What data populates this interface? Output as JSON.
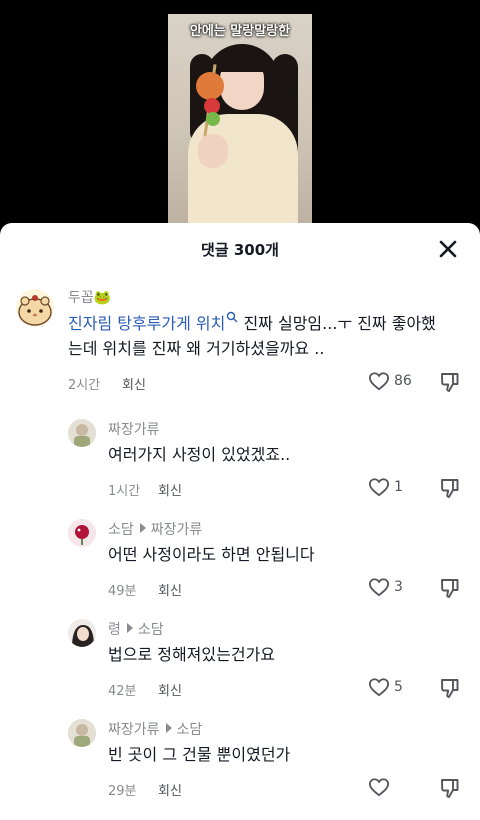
{
  "video": {
    "caption": "안에는 말랑말랑한"
  },
  "sheet": {
    "title": "댓글 300개"
  },
  "comments": [
    {
      "username": "두꼽🐸",
      "tag": "진자림 탕후루가게 위치",
      "text_line1": " 진짜 실망임...ㅜ 진짜 좋아했",
      "text_line2": "는데 위치를 진짜 왜 거기하셨을까요 ..",
      "time": "2시간",
      "reply_label": "회신",
      "likes": "86"
    },
    {
      "username": "짜장가류",
      "text": "여러가지 사정이 있었겠죠..",
      "time": "1시간",
      "reply_label": "회신",
      "likes": "1"
    },
    {
      "username": "소담",
      "reply_to": "짜장가류",
      "text": "어떤 사정이라도 하면 안됩니다",
      "time": "49분",
      "reply_label": "회신",
      "likes": "3"
    },
    {
      "username": "령",
      "reply_to": "소담",
      "text": "법으로 정해져있는건가요",
      "time": "42분",
      "reply_label": "회신",
      "likes": "5"
    },
    {
      "username": "짜장가류",
      "reply_to": "소담",
      "text": "빈 곳이 그 건물 뿐이였던가",
      "time": "29분",
      "reply_label": "회신",
      "likes": ""
    }
  ]
}
